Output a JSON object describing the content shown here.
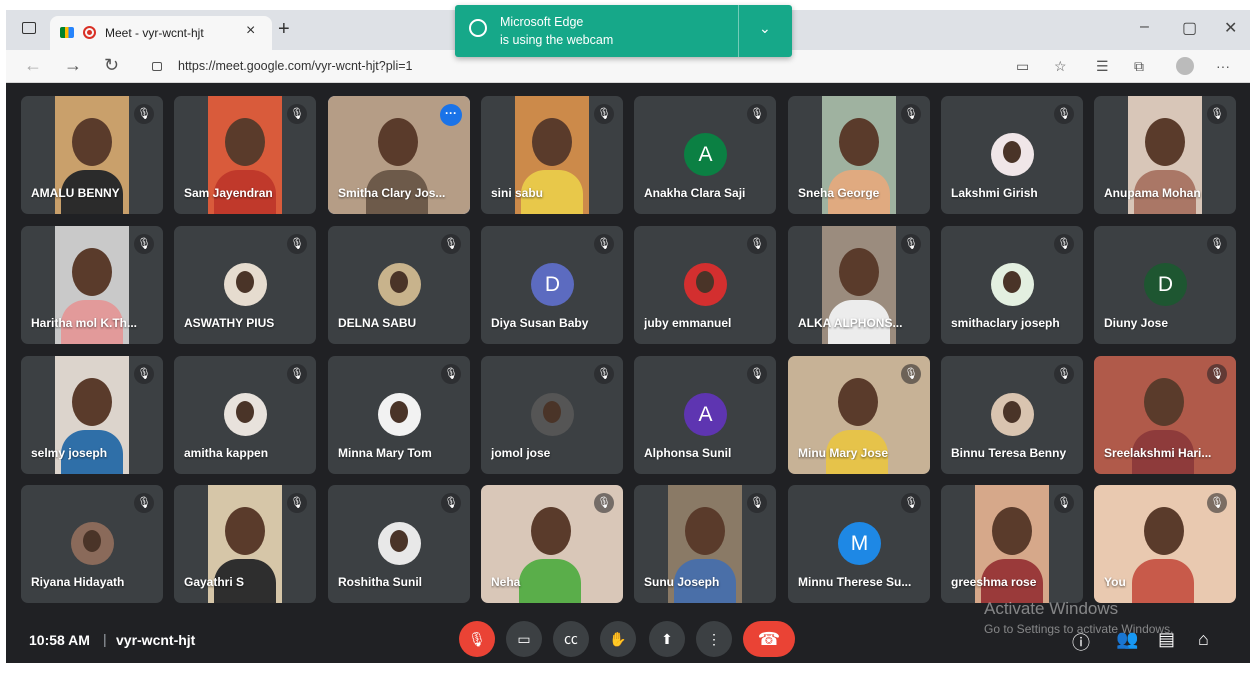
{
  "browser": {
    "tab_title": "Meet - vyr-wcnt-hjt",
    "url": "https://meet.google.com/vyr-wcnt-hjt?pli=1",
    "toast": {
      "line1": "Microsoft Edge",
      "line2": "is using the webcam"
    }
  },
  "participants": [
    {
      "name": "AMALU BENNY",
      "kind": "photo",
      "color": "#c9a06b",
      "shirt": "#2b2b2b",
      "wide": false
    },
    {
      "name": "Sam Jayendran",
      "kind": "photo",
      "color": "#d95b3b",
      "shirt": "#c0392b",
      "wide": false
    },
    {
      "name": "Smitha Clary Jos...",
      "kind": "photo",
      "color": "#b59d86",
      "shirt": "#6d5a4a",
      "wide": true,
      "active": true,
      "more": true
    },
    {
      "name": "sini sabu",
      "kind": "photo",
      "color": "#cc8a4a",
      "shirt": "#e8c84a",
      "wide": false
    },
    {
      "name": "Anakha Clara Saji",
      "kind": "letter",
      "letter": "A",
      "color": "#0b8043"
    },
    {
      "name": "Sneha George",
      "kind": "photo",
      "color": "#9fb2a0",
      "shirt": "#e0aa80",
      "wide": false
    },
    {
      "name": "Lakshmi Girish",
      "kind": "pic",
      "color": "#f0e6e8"
    },
    {
      "name": "Anupama Mohan",
      "kind": "photo",
      "color": "#d8c6b8",
      "shirt": "#aa7766",
      "wide": false
    },
    {
      "name": "Haritha mol K.Th...",
      "kind": "photo",
      "color": "#c9c9c9",
      "shirt": "#e29a9a",
      "wide": false
    },
    {
      "name": "ASWATHY PIUS",
      "kind": "pic",
      "color": "#e6dccf"
    },
    {
      "name": "DELNA SABU",
      "kind": "pic",
      "color": "#c8b38c"
    },
    {
      "name": "Diya Susan Baby",
      "kind": "letter",
      "letter": "D",
      "color": "#5c6bc0"
    },
    {
      "name": "juby emmanuel",
      "kind": "pic",
      "color": "#d32f2f"
    },
    {
      "name": "ALKA ALPHONS...",
      "kind": "photo",
      "color": "#9b8c7e",
      "shirt": "#ececec",
      "wide": false
    },
    {
      "name": "smithaclary joseph",
      "kind": "pic",
      "color": "#e3efe0"
    },
    {
      "name": "Diuny Jose",
      "kind": "letter",
      "letter": "D",
      "color": "#1e5631"
    },
    {
      "name": "selmy joseph",
      "kind": "photo",
      "color": "#dcd4cc",
      "shirt": "#2f6fa8",
      "wide": false
    },
    {
      "name": "amitha kappen",
      "kind": "pic",
      "color": "#e8e2dc"
    },
    {
      "name": "Minna Mary Tom",
      "kind": "pic",
      "color": "#f2f2f2"
    },
    {
      "name": "jomol jose",
      "kind": "pic",
      "color": "#555555"
    },
    {
      "name": "Alphonsa Sunil",
      "kind": "letter",
      "letter": "A",
      "color": "#5e35b1"
    },
    {
      "name": "Minu Mary Jose",
      "kind": "photo",
      "color": "#c7b296",
      "shirt": "#e6c34a",
      "wide": true
    },
    {
      "name": "Binnu Teresa Benny",
      "kind": "pic",
      "color": "#d9c4b0"
    },
    {
      "name": "Sreelakshmi Hari...",
      "kind": "photo",
      "color": "#b05a4a",
      "shirt": "#8e3b3b",
      "wide": true
    },
    {
      "name": "Riyana Hidayath",
      "kind": "pic",
      "color": "#8a6a5a"
    },
    {
      "name": "Gayathri S",
      "kind": "photo",
      "color": "#d6c6a8",
      "shirt": "#2e2e2e",
      "wide": false
    },
    {
      "name": "Roshitha Sunil",
      "kind": "pic",
      "color": "#e8e8e8"
    },
    {
      "name": "Neha",
      "kind": "photo",
      "color": "#d9c7b8",
      "shirt": "#5aae4a",
      "wide": true
    },
    {
      "name": "Sunu Joseph",
      "kind": "photo",
      "color": "#8a7a66",
      "shirt": "#4a6fa8",
      "wide": false
    },
    {
      "name": "Minnu Therese Su...",
      "kind": "letter",
      "letter": "M",
      "color": "#1e88e5"
    },
    {
      "name": "greeshma rose",
      "kind": "photo",
      "color": "#d6a88a",
      "shirt": "#9a3a3a",
      "wide": false
    },
    {
      "name": "You",
      "kind": "photo",
      "color": "#e9c9b0",
      "shirt": "#c85a4a",
      "wide": true
    }
  ],
  "bottom_bar": {
    "time": "10:58 AM",
    "separator": "|",
    "meeting_code": "vyr-wcnt-hjt"
  },
  "watermark": {
    "line1": "Activate Windows",
    "line2": "Go to Settings to activate Windows."
  }
}
